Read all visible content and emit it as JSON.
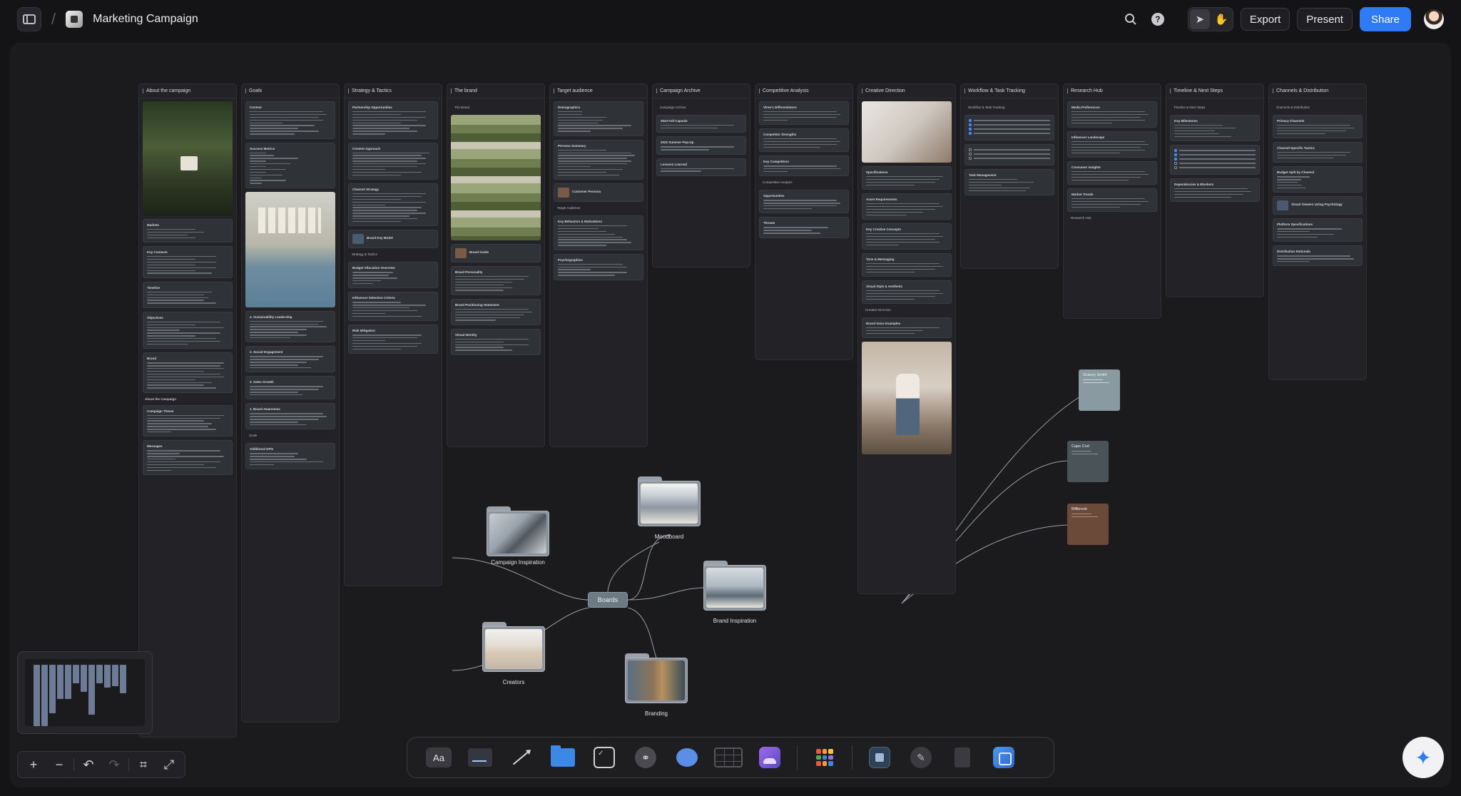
{
  "header": {
    "breadcrumb_separator": "/",
    "doc_title": "Marketing Campaign",
    "export_label": "Export",
    "present_label": "Present",
    "share_label": "Share"
  },
  "columns": [
    {
      "title": "About the campaign"
    },
    {
      "title": "Goals"
    },
    {
      "title": "Strategy & Tactics"
    },
    {
      "title": "The brand"
    },
    {
      "title": "Target audience"
    },
    {
      "title": "Campaign Archive"
    },
    {
      "title": "Competitive Analysis"
    },
    {
      "title": "Creative Direction"
    },
    {
      "title": "Workflow & Task Tracking"
    },
    {
      "title": "Research Hub"
    },
    {
      "title": "Timeline & Next Steps"
    },
    {
      "title": "Channels & Distribution"
    }
  ],
  "about": {
    "markets": "Markets",
    "key_contacts": "Key Contacts",
    "timeline": "Timeline",
    "objectives": "Objectives",
    "brand": "Brand",
    "about_section": "About the Campaign",
    "campaign_theme": "Campaign Theme",
    "messages": "Messages"
  },
  "goals": {
    "context": "Context",
    "success_metrics": "Success Metrics",
    "sustainability": "4. Sustainability Leadership",
    "social_engagement": "2. Social Engagement",
    "sales_growth": "3. Sales Growth",
    "brand_awareness": "1. Brand Awareness",
    "scale": "Scale",
    "additional_kpis": "Additional KPIs"
  },
  "strategy": {
    "partnership": "Partnership Opportunities",
    "content_approach": "Content Approach",
    "channel_strategy": "Channel Strategy",
    "brand_key_model": "Brand Key Model",
    "sub": "Strategy & Tactics",
    "budget": "Budget Allocation Overview",
    "influencer": "Influencer Selection Criteria",
    "risk": "Risk Mitigation"
  },
  "brand": {
    "sub": "The Brand",
    "brand_guide": "Brand Guide",
    "personality": "Brand Personality",
    "positioning": "Brand Positioning Statement",
    "visual_identity": "Visual Identity"
  },
  "audience": {
    "demographics": "Demographics",
    "persona": "Persona Summary",
    "customer_persona": "Customer Persona",
    "sub": "Target Audience",
    "behaviors": "Key Behaviors & Motivations",
    "psychographics": "Psychographics"
  },
  "archive": {
    "sub": "Campaign Archive",
    "fall": "2023 Fall Capsule",
    "summer": "2022 Summer Pop-Up",
    "lessons": "Lessons Learned"
  },
  "competitive": {
    "differentiators": "Vireo's Differentiators",
    "strengths": "Competitor Strengths",
    "key_competitors": "Key Competitors",
    "sub": "Competitive Analysis",
    "opportunities": "Opportunities",
    "threats": "Threats"
  },
  "creative": {
    "specifications": "Specifications",
    "asset_requirements": "Asset Requirements",
    "key_concepts": "Key Creative Concepts",
    "tone": "Tone & Messaging",
    "visual_style": "Visual Style & Aesthetic",
    "sub": "Creative Direction",
    "voice_examples": "Brand Voice Examples"
  },
  "workflow": {
    "sub": "Workflow & Task Tracking",
    "task_management": "Task Management"
  },
  "research": {
    "media": "Media Preferences",
    "influencer_landscape": "Influencer Landscape",
    "consumer_insights": "Consumer Insights",
    "market_trends": "Market Trends",
    "sub": "Research Hub"
  },
  "timeline": {
    "sub": "Timeline & Next Steps",
    "milestones": "Key Milestones",
    "dependencies": "Dependencies & Blockers"
  },
  "channels": {
    "sub": "Channels & Distribution",
    "primary": "Primary Channels",
    "specific": "Channel-Specific Tactics",
    "budget_split": "Budget Split by Channel",
    "visual_viewers": "Visual Viewers Using Psychology",
    "platform_specs": "Platform Specifications",
    "distribution": "Distribution Rationale"
  },
  "boards": {
    "hub": "Boards",
    "campaign_inspiration": "Campaign Inspiration",
    "moodboard": "Moodboard",
    "brand_inspiration": "Brand Inspiration",
    "creators": "Creators",
    "branding": "Branding"
  },
  "swatches": [
    {
      "name": "Granny Smith",
      "color": "#8a9aa1"
    },
    {
      "name": "Cape Cod",
      "color": "#4a5358"
    },
    {
      "name": "Millbrook",
      "color": "#6b4a3a"
    }
  ],
  "icons": {
    "sidebar": "sidebar-icon",
    "search": "search-icon",
    "help": "help-icon",
    "pointer": "pointer-icon",
    "hand": "hand-icon",
    "ai": "sparkle-icon"
  },
  "toolbar": {
    "text_tool": "Aa"
  }
}
